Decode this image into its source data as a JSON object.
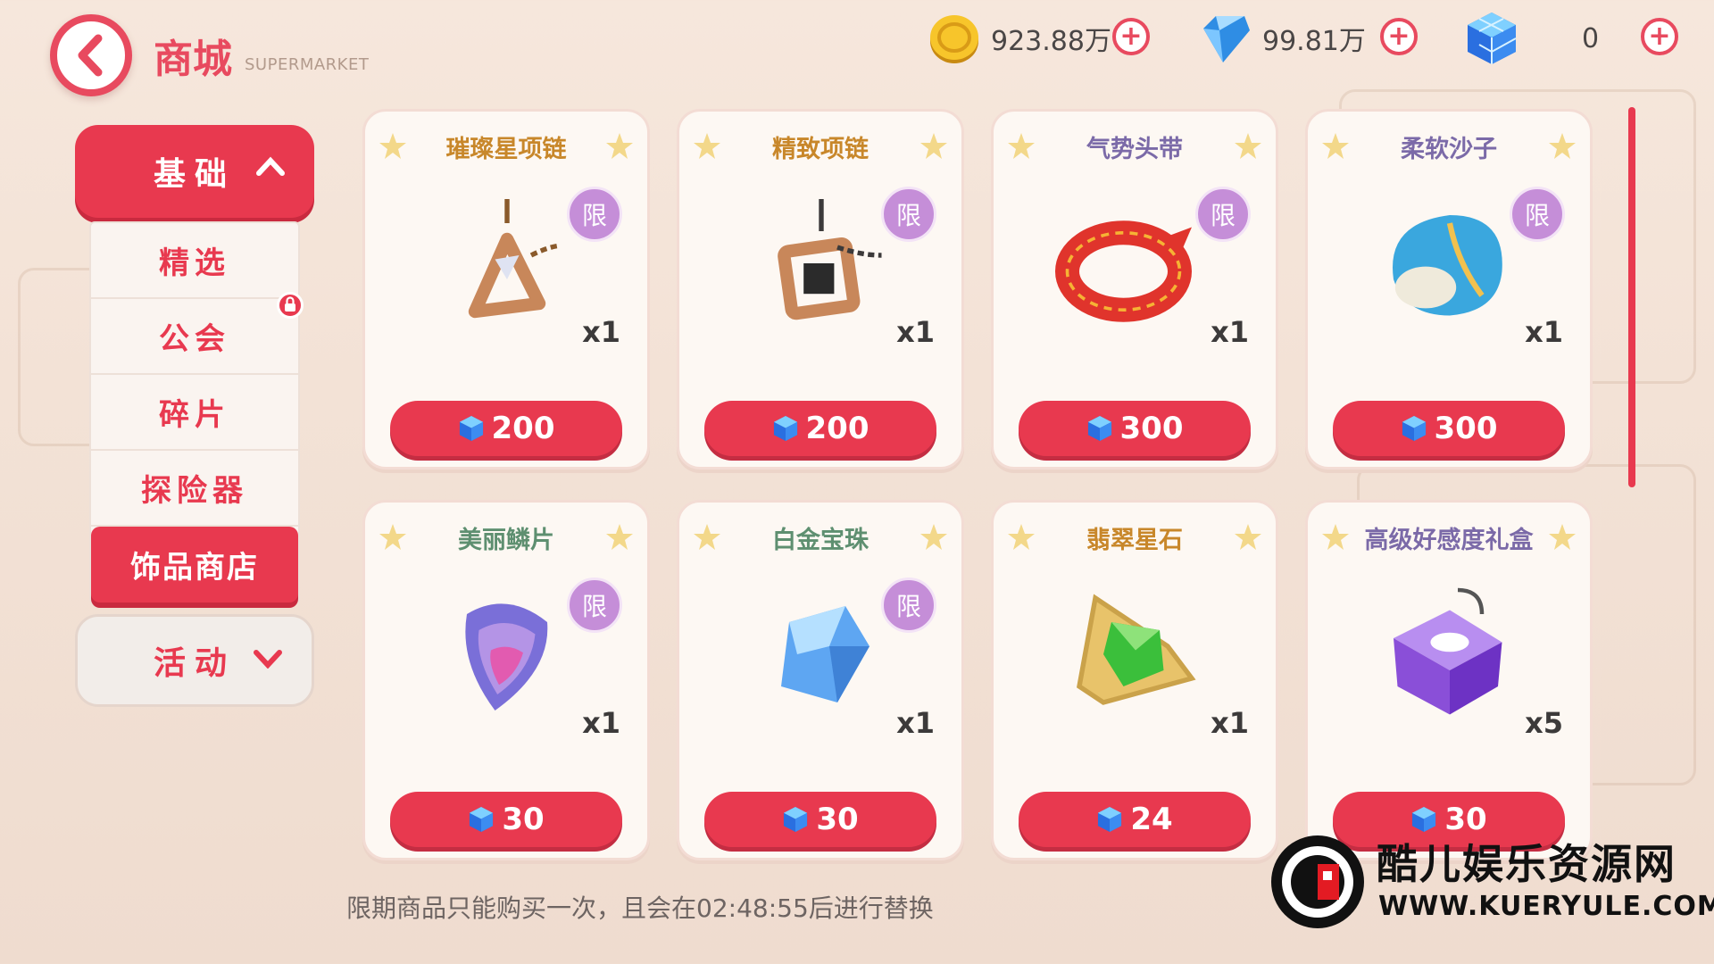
{
  "header": {
    "title": "商城",
    "subtitle": "SUPERMARKET"
  },
  "currencies": [
    {
      "icon": "gold-coin-icon",
      "value": "923.88万"
    },
    {
      "icon": "diamond-icon",
      "value": "99.81万"
    },
    {
      "icon": "blue-cube-icon",
      "value": "0"
    }
  ],
  "sidebar": {
    "basic_label": "基础",
    "items": [
      {
        "label": "精选"
      },
      {
        "label": "公会"
      },
      {
        "label": "碎片"
      },
      {
        "label": "探险器"
      },
      {
        "label": "饰品商店"
      }
    ],
    "event_label": "活动"
  },
  "products": [
    {
      "name": "璀璨星项链",
      "name_color": "#c8872a",
      "limited": "限",
      "qty": "x1",
      "price": "200",
      "icon": "triangle-necklace-icon"
    },
    {
      "name": "精致项链",
      "name_color": "#c8872a",
      "limited": "限",
      "qty": "x1",
      "price": "200",
      "icon": "square-necklace-icon"
    },
    {
      "name": "气势头带",
      "name_color": "#7b6aa8",
      "limited": "限",
      "qty": "x1",
      "price": "300",
      "icon": "red-headband-icon"
    },
    {
      "name": "柔软沙子",
      "name_color": "#7b6aa8",
      "limited": "限",
      "qty": "x1",
      "price": "300",
      "icon": "sand-bag-icon"
    },
    {
      "name": "美丽鳞片",
      "name_color": "#5e8f70",
      "limited": "限",
      "qty": "x1",
      "price": "30",
      "icon": "scale-icon"
    },
    {
      "name": "白金宝珠",
      "name_color": "#5e8f70",
      "limited": "限",
      "qty": "x1",
      "price": "30",
      "icon": "crystal-icon"
    },
    {
      "name": "翡翠星石",
      "name_color": "#c8872a",
      "limited": "",
      "qty": "x1",
      "price": "24",
      "icon": "emerald-star-icon"
    },
    {
      "name": "高级好感度礼盒",
      "name_color": "#7b6aa8",
      "limited": "",
      "qty": "x5",
      "price": "30",
      "icon": "gift-box-icon"
    }
  ],
  "notice": "限期商品只能购买一次，且会在02:48:55后进行替换",
  "watermark": {
    "title": "酷儿娱乐资源网",
    "url": "WWW.KUERYULE.COM"
  },
  "colors": {
    "accent": "#e8394f",
    "card_bg": "#fdf8f3",
    "limit_badge": "#c58ed8"
  }
}
